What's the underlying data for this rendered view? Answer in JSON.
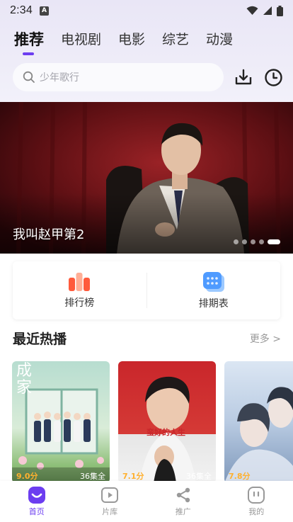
{
  "status_bar": {
    "time": "2:34",
    "app_badge": "A"
  },
  "tabs": [
    {
      "label": "推荐",
      "active": true
    },
    {
      "label": "电视剧",
      "active": false
    },
    {
      "label": "电影",
      "active": false
    },
    {
      "label": "综艺",
      "active": false
    },
    {
      "label": "动漫",
      "active": false
    }
  ],
  "search": {
    "placeholder": "少年歌行"
  },
  "header_icons": {
    "download": "download-icon",
    "history": "clock-icon"
  },
  "banner": {
    "title": "我叫赵甲第2",
    "page_count": 5,
    "active_index": 4
  },
  "quick_links": [
    {
      "label": "排行榜",
      "icon": "ranking-icon"
    },
    {
      "label": "排期表",
      "icon": "schedule-icon"
    }
  ],
  "recent": {
    "title": "最近热播",
    "more": "更多 >",
    "items": [
      {
        "score": "9.0分",
        "episodes": "36集全",
        "poster_text": "成家",
        "colors": [
          "#a7d3c7",
          "#e4f0de"
        ]
      },
      {
        "score": "7.1分",
        "episodes": "36集全",
        "poster_text": "蛮好的人生",
        "colors": [
          "#c92a2a",
          "#e9e9e9"
        ]
      },
      {
        "score": "7.8分",
        "episodes": "",
        "poster_text": "",
        "colors": [
          "#c7d6ea",
          "#8fa8c6"
        ]
      }
    ]
  },
  "bottom_nav": [
    {
      "label": "首页",
      "active": true
    },
    {
      "label": "片库",
      "active": false
    },
    {
      "label": "推广",
      "active": false
    },
    {
      "label": "我的",
      "active": false
    }
  ],
  "colors": {
    "accent": "#6c3df0",
    "score": "#ffb02e"
  }
}
